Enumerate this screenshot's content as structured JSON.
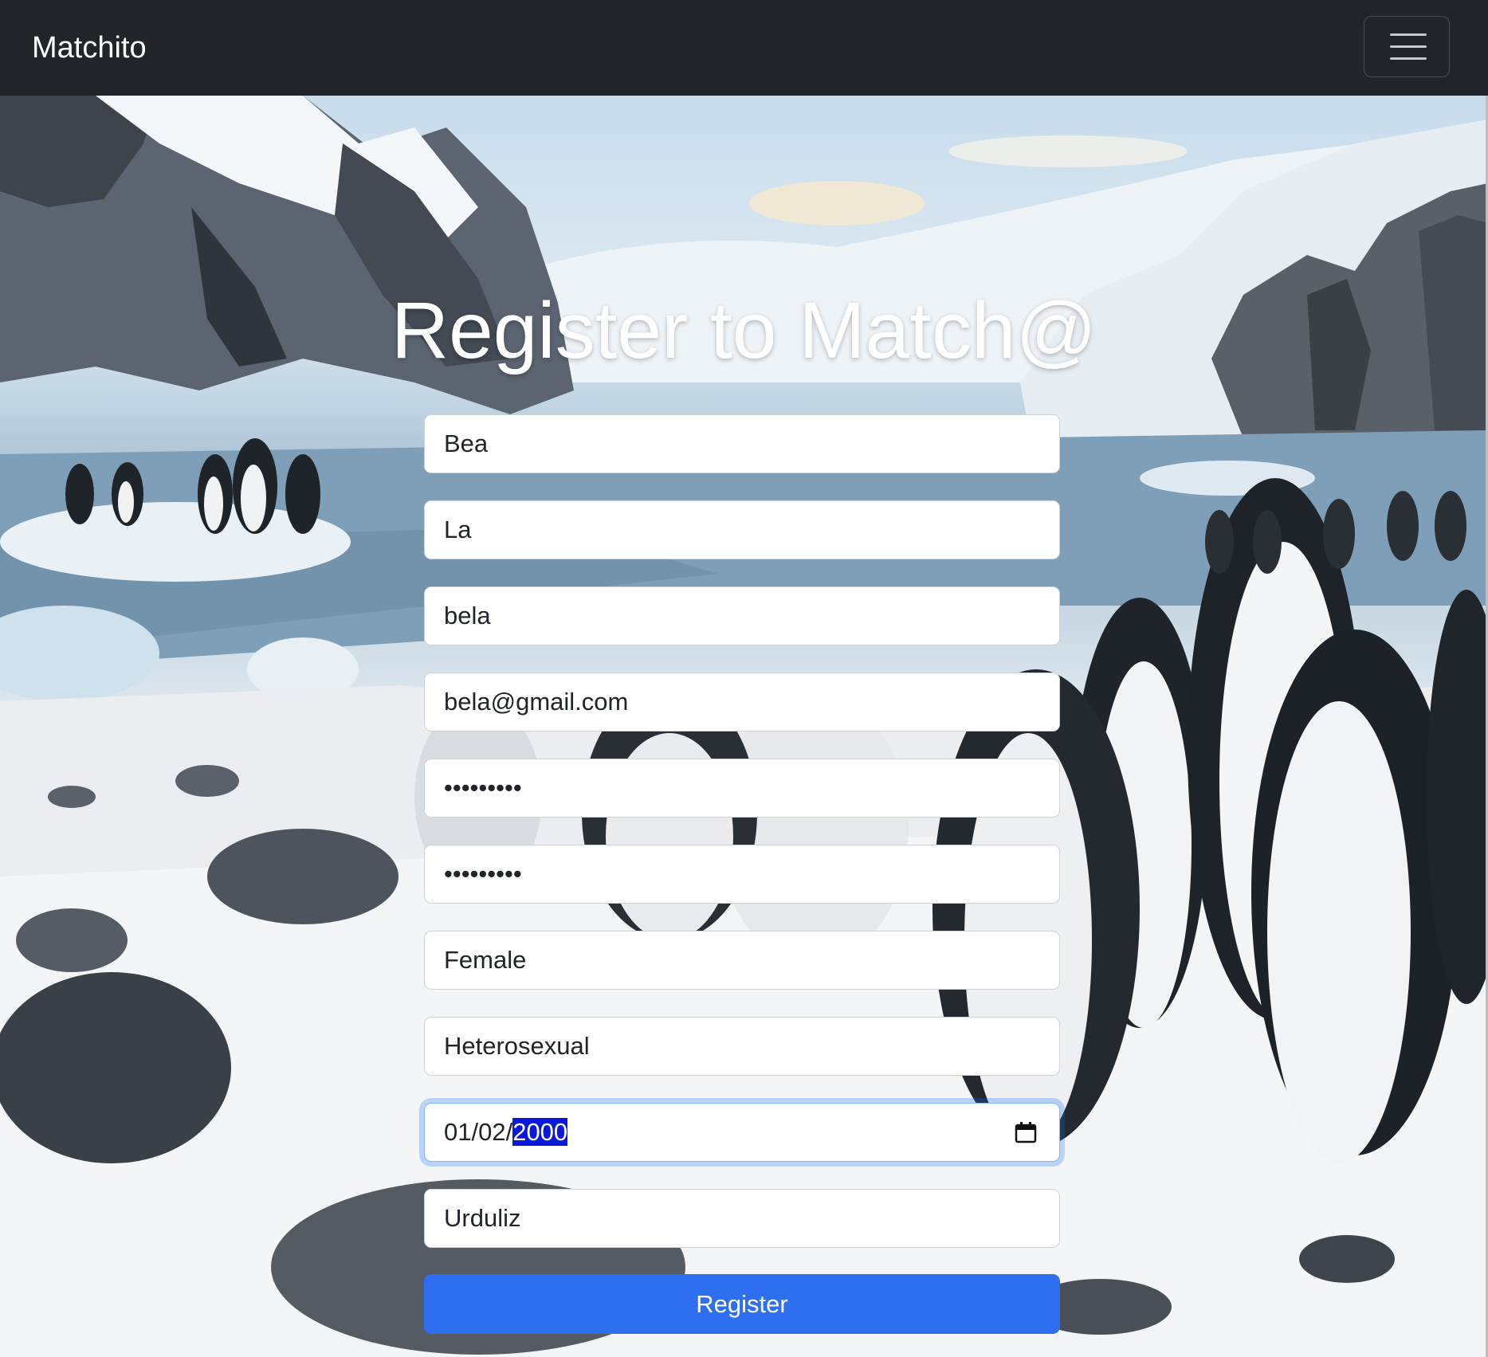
{
  "navbar": {
    "brand": "Matchito",
    "menu_icon": "hamburger-menu-icon"
  },
  "page": {
    "title": "Register to Match@"
  },
  "form": {
    "first_name": "Bea",
    "last_name": "La",
    "username": "bela",
    "email": "bela@gmail.com",
    "password": "•••••••••",
    "confirm_password": "•••••••••",
    "gender": "Female",
    "orientation": "Heterosexual",
    "birthdate": {
      "prefix": "01/02/",
      "year_selected": "2000",
      "icon": "calendar-icon"
    },
    "city": "Urduliz",
    "submit_label": "Register"
  },
  "colors": {
    "navbar_bg": "#212529",
    "primary_button": "#2e6ff0",
    "selection_highlight": "#0a19d9",
    "focus_ring": "#86b7fe"
  },
  "background": {
    "description_icon": "penguins-antarctic-landscape-photo"
  }
}
